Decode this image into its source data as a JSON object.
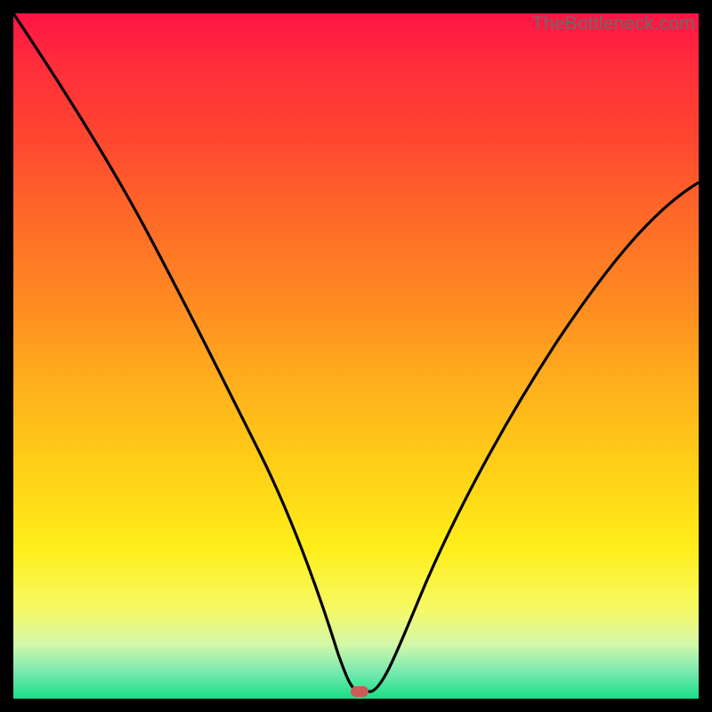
{
  "watermark": "TheBottleneck.com",
  "chart_data": {
    "type": "line",
    "title": "",
    "xlabel": "",
    "ylabel": "",
    "xlim": [
      0,
      100
    ],
    "ylim": [
      0,
      100
    ],
    "series": [
      {
        "name": "bottleneck-curve",
        "x": [
          0,
          3,
          7,
          12,
          17,
          22,
          27,
          32,
          37,
          42,
          46,
          48,
          49,
          50,
          51,
          53,
          56,
          62,
          70,
          80,
          90,
          100
        ],
        "values": [
          100,
          96,
          90,
          82,
          74,
          65,
          55,
          45,
          34,
          22,
          11,
          5,
          2,
          1,
          1,
          3,
          8,
          18,
          32,
          49,
          63,
          75
        ]
      }
    ],
    "marker": {
      "x": 50,
      "y": 0.8,
      "color": "#cc5a56"
    }
  }
}
